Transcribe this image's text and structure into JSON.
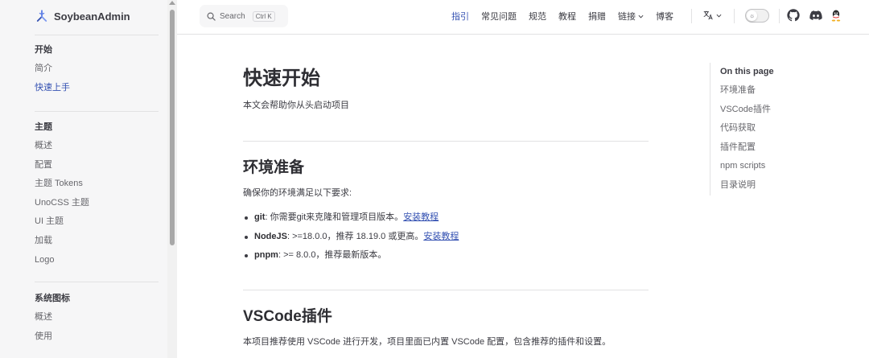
{
  "brand": {
    "name": "SoybeanAdmin",
    "logo_icon": "soybean-logo-icon"
  },
  "sidebar": {
    "groups": [
      {
        "title": "开始",
        "items": [
          {
            "label": "简介"
          },
          {
            "label": "快速上手"
          }
        ]
      },
      {
        "title": "主题",
        "items": [
          {
            "label": "概述"
          },
          {
            "label": "配置"
          },
          {
            "label": "主题 Tokens"
          },
          {
            "label": "UnoCSS 主题"
          },
          {
            "label": "UI 主题"
          },
          {
            "label": "加载"
          },
          {
            "label": "Logo"
          }
        ]
      },
      {
        "title": "系统图标",
        "items": [
          {
            "label": "概述"
          },
          {
            "label": "使用"
          }
        ]
      }
    ],
    "active_item": "快速上手"
  },
  "search": {
    "label": "Search",
    "shortcut": "Ctrl K"
  },
  "topnav": {
    "items": [
      {
        "label": "指引"
      },
      {
        "label": "常见问题"
      },
      {
        "label": "规范"
      },
      {
        "label": "教程"
      },
      {
        "label": "捐赠"
      },
      {
        "label": "链接"
      },
      {
        "label": "博客"
      }
    ],
    "active": "指引",
    "social": [
      "github-icon",
      "discord-icon",
      "qq-icon"
    ]
  },
  "page": {
    "title": "快速开始",
    "lead": "本文会帮助你从头启动项目",
    "sections": {
      "env": {
        "heading": "环境准备",
        "intro": "确保你的环境满足以下要求:",
        "requirements": [
          {
            "name": "git",
            "text": ": 你需要git来克隆和管理项目版本。",
            "link": "安装教程"
          },
          {
            "name": "NodeJS",
            "text": ": >=18.0.0，推荐 18.19.0 或更高。",
            "link": "安装教程"
          },
          {
            "name": "pnpm",
            "text": ": >= 8.0.0，推荐最新版本。",
            "link": ""
          }
        ]
      },
      "vscode": {
        "heading": "VSCode插件",
        "intro": "本项目推荐使用 VSCode 进行开发，项目里面已内置 VSCode 配置，包含推荐的插件和设置。"
      }
    }
  },
  "outline": {
    "title": "On this page",
    "items": [
      "环境准备",
      "VSCode插件",
      "代码获取",
      "插件配置",
      "npm scripts",
      "目录说明"
    ]
  },
  "colors": {
    "accent": "#3451b2",
    "text": "#3c3c43",
    "muted": "#67676c",
    "sidebar_bg": "#f6f6f7",
    "divider": "#e2e2e3"
  }
}
